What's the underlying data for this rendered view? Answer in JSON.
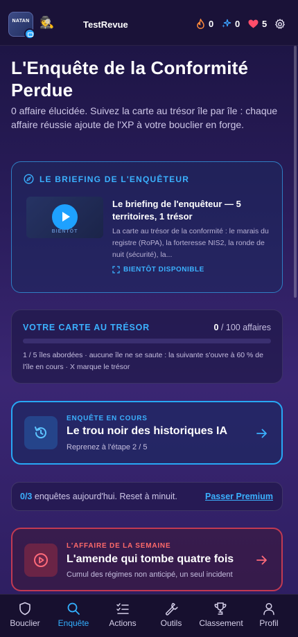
{
  "header": {
    "logo_text": "NATAN",
    "username": "TestRevue",
    "stats": [
      {
        "icon": "flame-icon",
        "value": "0"
      },
      {
        "icon": "sparkle-icon",
        "value": "0"
      },
      {
        "icon": "heart-icon",
        "value": "5"
      }
    ]
  },
  "page": {
    "title": "L'Enquête de la Conformité Perdue",
    "intro": "0 affaire élucidée. Suivez la carte au trésor île par île : chaque affaire réussie ajoute de l'XP à votre bouclier en forge."
  },
  "briefing": {
    "heading": "LE BRIEFING DE L'ENQUÊTEUR",
    "video_tag": "BIENTÔT",
    "title": "Le briefing de l'enquêteur — 5 territoires, 1 trésor",
    "description": "La carte au trésor de la conformité : le marais du registre (RoPA), la forteresse NIS2, la ronde de nuit (sécurité), la...",
    "soon_label": "BIENTÔT DISPONIBLE"
  },
  "treasure_map": {
    "title": "VOTRE CARTE AU TRÉSOR",
    "solved": "0",
    "total_label": " / 100 affaires",
    "progress": 0,
    "note": "1 / 5 îles abordées · aucune île ne se saute : la suivante s'ouvre à 60 % de l'île en cours · X marque le trésor"
  },
  "current_case": {
    "label": "ENQUÊTE EN COURS",
    "title": "Le trou noir des historiques IA",
    "subtitle": "Reprenez à l'étape 2 / 5"
  },
  "daily_limit": {
    "count": "0/3",
    "text": " enquêtes aujourd'hui. Reset à minuit.",
    "premium_link": "Passer Premium"
  },
  "weekly_case": {
    "label": "L'AFFAIRE DE LA SEMAINE",
    "title": "L'amende qui tombe quatre fois",
    "subtitle": "Cumul des régimes non anticipé, un seul incident"
  },
  "tabs": [
    {
      "label": "Bouclier",
      "icon": "shield-icon",
      "active": false
    },
    {
      "label": "Enquête",
      "icon": "search-icon",
      "active": true
    },
    {
      "label": "Actions",
      "icon": "checklist-icon",
      "active": false
    },
    {
      "label": "Outils",
      "icon": "wrench-icon",
      "active": false
    },
    {
      "label": "Classement",
      "icon": "trophy-icon",
      "active": false
    },
    {
      "label": "Profil",
      "icon": "user-icon",
      "active": false
    }
  ],
  "colors": {
    "accent": "#2ea8ff",
    "alert": "#c23a52",
    "background": "#2a1d5c"
  }
}
